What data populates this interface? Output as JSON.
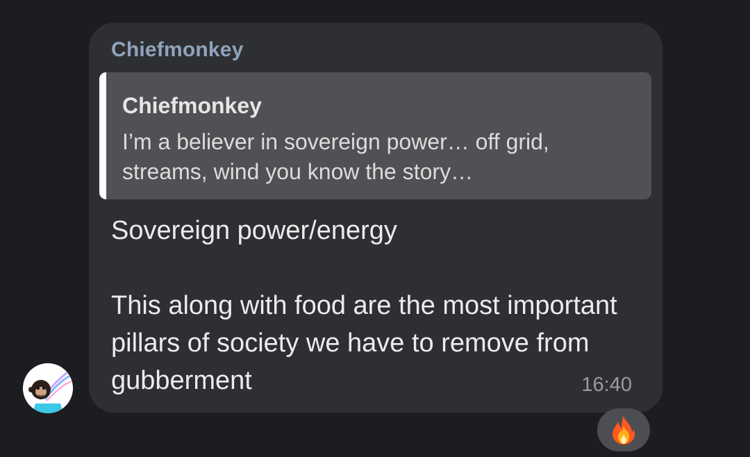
{
  "message": {
    "sender": "Chiefmonkey",
    "reply": {
      "author": "Chiefmonkey",
      "text": "I’m a believer in sovereign power… off grid, streams, wind you know the story…"
    },
    "lines": [
      "Sovereign power/energy",
      "This along with food are the most important pillars of society we have to remove from gubberment"
    ],
    "time": "16:40"
  },
  "avatar": {
    "icon": "monkey-avatar-icon"
  },
  "reaction": {
    "emoji": "fire-icon"
  },
  "colors": {
    "background": "#1c1d21",
    "bubble": "#2e2f33",
    "sender_name": "#8fa4bc",
    "reply_background": "#505154",
    "reply_bar": "#ffffff",
    "time": "#9a9ba0"
  }
}
